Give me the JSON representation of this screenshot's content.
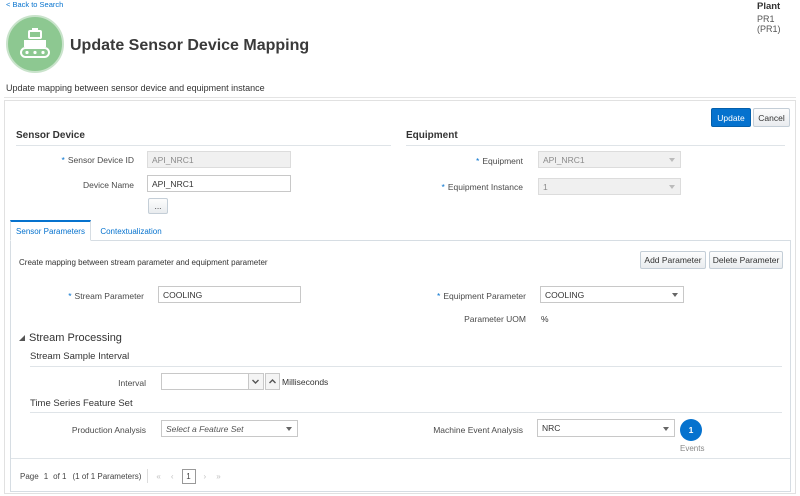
{
  "nav": {
    "back_label": "< Back to Search"
  },
  "plant": {
    "label": "Plant",
    "value": "PR1 (PR1)"
  },
  "header": {
    "title": "Update Sensor Device Mapping",
    "subtitle": "Update mapping between sensor device and equipment instance",
    "icon": "sensor-device-icon"
  },
  "actions": {
    "update_label": "Update",
    "cancel_label": "Cancel"
  },
  "sensor_device": {
    "section_title": "Sensor Device",
    "id_label": "Sensor Device ID",
    "id_value": "API_NRC1",
    "name_label": "Device Name",
    "name_value": "API_NRC1",
    "more_label": "..."
  },
  "equipment": {
    "section_title": "Equipment",
    "equipment_label": "Equipment",
    "equipment_value": "API_NRC1",
    "instance_label": "Equipment Instance",
    "instance_value": "1"
  },
  "tabs": [
    {
      "label": "Sensor Parameters",
      "active": true
    },
    {
      "label": "Contextualization",
      "active": false
    }
  ],
  "parameters": {
    "description": "Create mapping between stream parameter and equipment parameter",
    "add_label": "Add Parameter",
    "delete_label": "Delete Parameter",
    "stream_label": "Stream Parameter",
    "stream_value": "COOLING",
    "equip_label": "Equipment Parameter",
    "equip_value": "COOLING",
    "uom_label": "Parameter UOM",
    "uom_value": "%"
  },
  "stream_processing": {
    "title": "Stream Processing",
    "interval_section": "Stream Sample Interval",
    "interval_label": "Interval",
    "interval_value": "",
    "interval_unit": "Milliseconds",
    "feature_section": "Time Series Feature Set",
    "production_label": "Production Analysis",
    "production_placeholder": "Select a Feature Set",
    "machine_label": "Machine Event Analysis",
    "machine_value": "NRC",
    "events_count": "1",
    "events_label": "Events"
  },
  "pagination": {
    "page_label": "Page",
    "page_value": "1",
    "of_label": "of 1",
    "summary": "(1 of 1 Parameters)",
    "current": "1"
  },
  "colors": {
    "accent": "#0572ce",
    "icon_circle": "#8dc891"
  }
}
